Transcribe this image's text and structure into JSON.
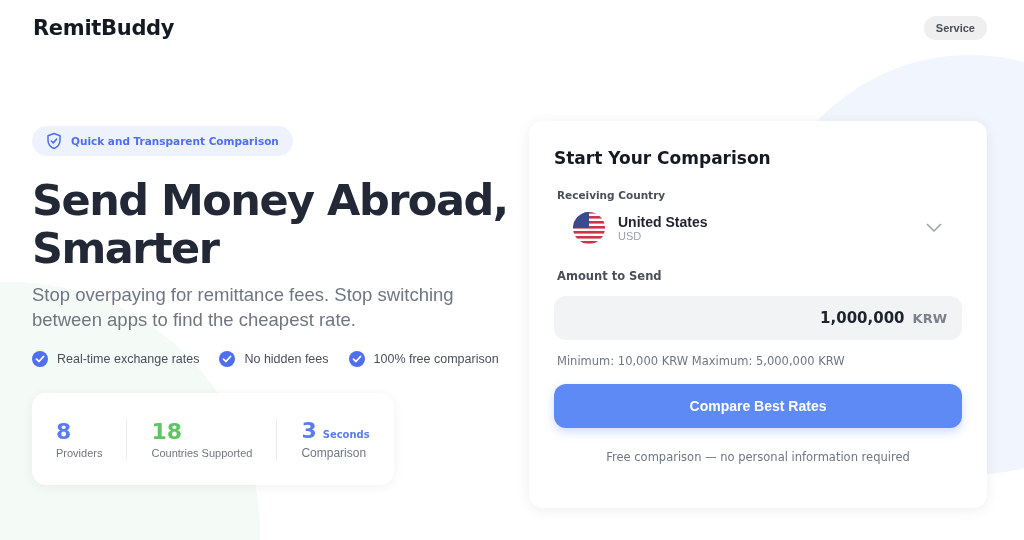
{
  "header": {
    "logo": "RemitBuddy",
    "service_button": "Service"
  },
  "hero": {
    "badge": "Quick and Transparent Comparison",
    "title_lines": [
      "Send Money Abroad,",
      "Smarter"
    ],
    "subtitle": "Stop overpaying for remittance fees. Stop switching between apps to find the cheapest rate.",
    "features": [
      "Real-time exchange rates",
      "No hidden fees",
      "100% free comparison"
    ],
    "stats": [
      {
        "value": "8",
        "label": "Providers",
        "color": "#5b7cf0"
      },
      {
        "value": "18",
        "label": "Countries Supported",
        "color": "#5fc463"
      },
      {
        "value": "3",
        "suffix": "Seconds",
        "label": "Comparison",
        "color": "#5b7cf0"
      }
    ]
  },
  "form": {
    "title": "Start Your Comparison",
    "country_label": "Receiving Country",
    "country": "United States",
    "currency": "USD",
    "amount_label": "Amount to Send",
    "amount": "1,000,000",
    "amount_currency": "KRW",
    "limits": "Minimum: 10,000 KRW Maximum: 5,000,000 KRW",
    "submit": "Compare Best Rates",
    "note": "Free comparison — no personal information required"
  }
}
